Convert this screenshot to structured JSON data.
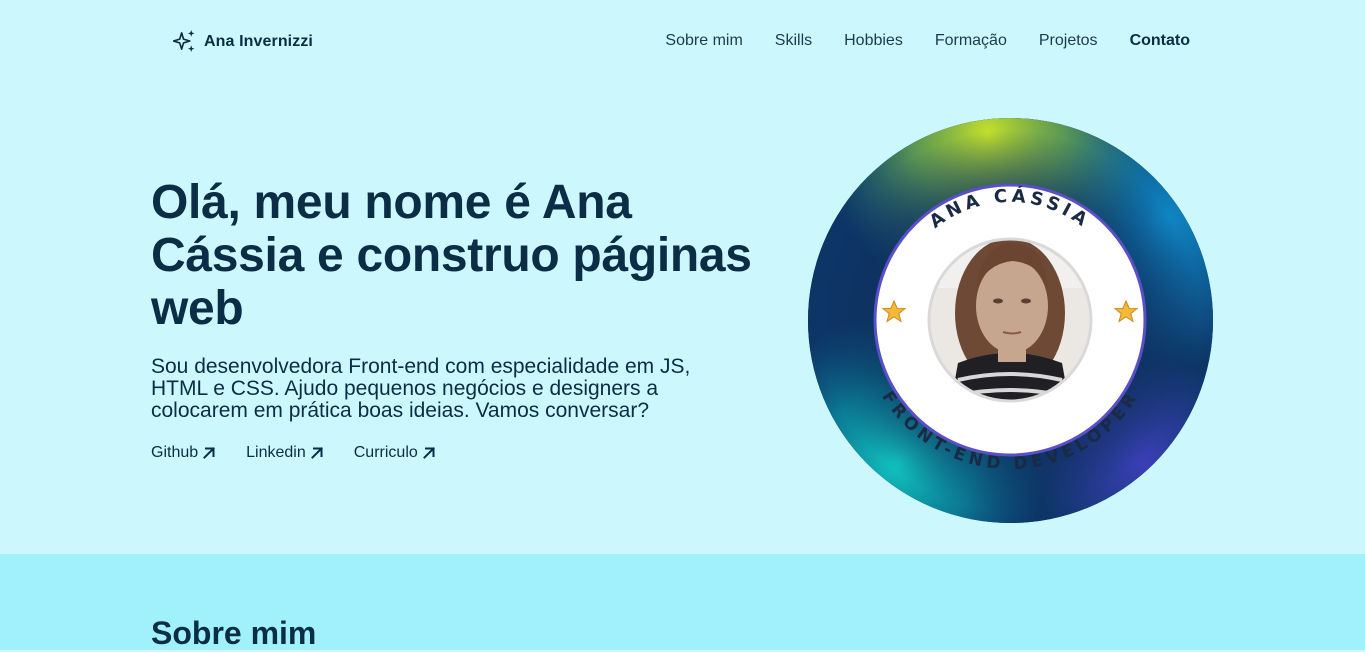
{
  "header": {
    "brand": "Ana Invernizzi",
    "brand_icon": "sparkles-icon",
    "nav": [
      {
        "label": "Sobre mim"
      },
      {
        "label": "Skills"
      },
      {
        "label": "Hobbies"
      },
      {
        "label": "Formação"
      },
      {
        "label": "Projetos"
      },
      {
        "label": "Contato"
      }
    ]
  },
  "intro": {
    "title": "Olá, meu nome é Ana Cássia e construo páginas web",
    "subtitle": "Sou desenvolvedora Front-end com especialidade em JS, HTML e CSS. Ajudo pequenos negócios e designers a colocarem em prática boas ideias. Vamos conversar?",
    "links": [
      {
        "label": "Github",
        "icon": "arrow-up-right-icon"
      },
      {
        "label": "Linkedin",
        "icon": "arrow-up-right-icon"
      },
      {
        "label": "Curriculo",
        "icon": "arrow-up-right-icon"
      }
    ]
  },
  "badge": {
    "top_text": "ANA CÁSSIA",
    "bottom_text": "FRONT-END DEVELOPER",
    "icon": "star-icon"
  },
  "about": {
    "title": "Sobre mim"
  },
  "colors": {
    "background": "#ccf8fd",
    "section_background": "#a0f1fb",
    "text": "#0b2d45",
    "badge_ring": "#5b4fc8",
    "star": "#f5b93a"
  }
}
